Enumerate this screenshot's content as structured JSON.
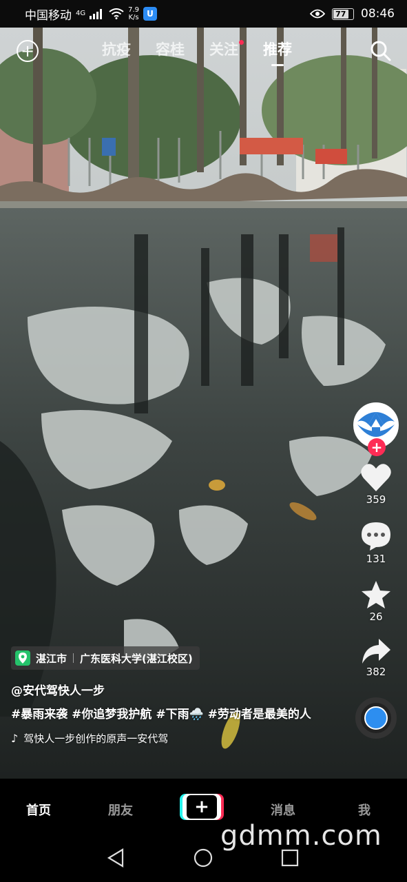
{
  "status_bar": {
    "carrier": "中国移动",
    "network": "4G",
    "net_speed_value": "7.9",
    "net_speed_unit": "K/s",
    "app_badge": "U",
    "battery": "77",
    "time": "08:46"
  },
  "top_nav": {
    "tabs": [
      {
        "label": "抗疫",
        "active": false,
        "dot": false
      },
      {
        "label": "容桂",
        "active": false,
        "dot": false
      },
      {
        "label": "关注",
        "active": false,
        "dot": true
      },
      {
        "label": "推荐",
        "active": true,
        "dot": false
      }
    ]
  },
  "actions": {
    "like_count": "359",
    "comment_count": "131",
    "favorite_count": "26",
    "share_count": "382"
  },
  "video_info": {
    "location_city": "湛江市",
    "location_place": "广东医科大学(湛江校区)",
    "author": "@安代驾快人一步",
    "description": "#暴雨来袭 #你追梦我护航 #下雨🌧️ #劳动者是最美的人",
    "music": "驾快人一步创作的原声一安代驾"
  },
  "bottom_nav": {
    "home": "首页",
    "friends": "朋友",
    "messages": "消息",
    "me": "我"
  },
  "watermark": "gdmm.com",
  "colors": {
    "accent_red": "#fe2c55",
    "accent_cyan": "#25f4ee",
    "location_green": "#25c26b"
  }
}
